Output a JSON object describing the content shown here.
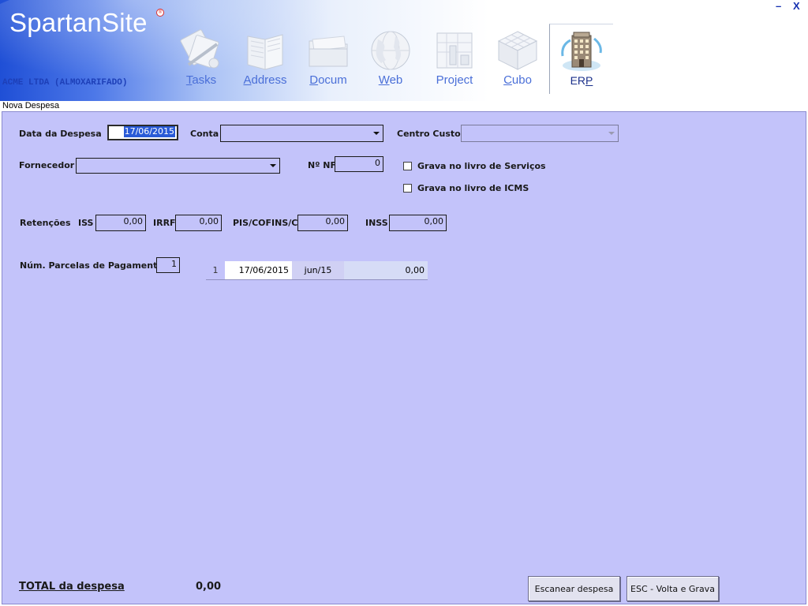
{
  "app": {
    "logo": "SpartanSite",
    "logo_mark": "®",
    "company": "ACME LTDA (ALMOXARIFADO)",
    "minimize": "–",
    "close": "X"
  },
  "nav": [
    {
      "pre": "",
      "u": "T",
      "post": "asks",
      "icon": "tasks-icon"
    },
    {
      "pre": "",
      "u": "A",
      "post": "ddress",
      "icon": "address-book-icon"
    },
    {
      "pre": "",
      "u": "D",
      "post": "ocum",
      "icon": "folder-icon"
    },
    {
      "pre": "",
      "u": "W",
      "post": "eb",
      "icon": "globe-icon"
    },
    {
      "pre": "Pro",
      "u": "j",
      "post": "ect",
      "icon": "project-icon"
    },
    {
      "pre": "",
      "u": "C",
      "post": "ubo",
      "icon": "cube-icon"
    },
    {
      "pre": "ER",
      "u": "P",
      "post": "",
      "icon": "erp-building-icon"
    }
  ],
  "form": {
    "title": "Nova Despesa",
    "data_label": "Data da Despesa",
    "data_value": "17/06/2015",
    "conta_label": "Conta",
    "conta_value": "",
    "centro_label": "Centro Custo",
    "centro_value": "",
    "fornecedor_label": "Fornecedor",
    "fornecedor_value": "",
    "nf_label": "Nº NF",
    "nf_value": "0",
    "chk_servicos_label": "Grava no livro de Serviços",
    "chk_icms_label": "Grava no livro de ICMS",
    "retencoes_label": "Retenções",
    "iss_label": "ISS",
    "iss_value": "0,00",
    "irrf_label": "IRRF",
    "irrf_value": "0,00",
    "pis_label": "PIS/COFINS/CS",
    "pis_value": "0,00",
    "inss_label": "INSS",
    "inss_value": "0,00",
    "parcelas_label": "Núm. Parcelas de Pagamento",
    "parcelas_value": "1",
    "parcelas": [
      {
        "num": "1",
        "date": "17/06/2015",
        "month": "jun/15",
        "amount": "0,00"
      }
    ],
    "total_label": "TOTAL da despesa",
    "total_value": "0,00",
    "scan_button": "Escanear despesa",
    "esc_button": "ESC - Volta e Grava"
  },
  "colors": {
    "panel": "#c3c3fa",
    "header_blue": "#1f4fd6",
    "nav_text": "#4a6fd8"
  }
}
